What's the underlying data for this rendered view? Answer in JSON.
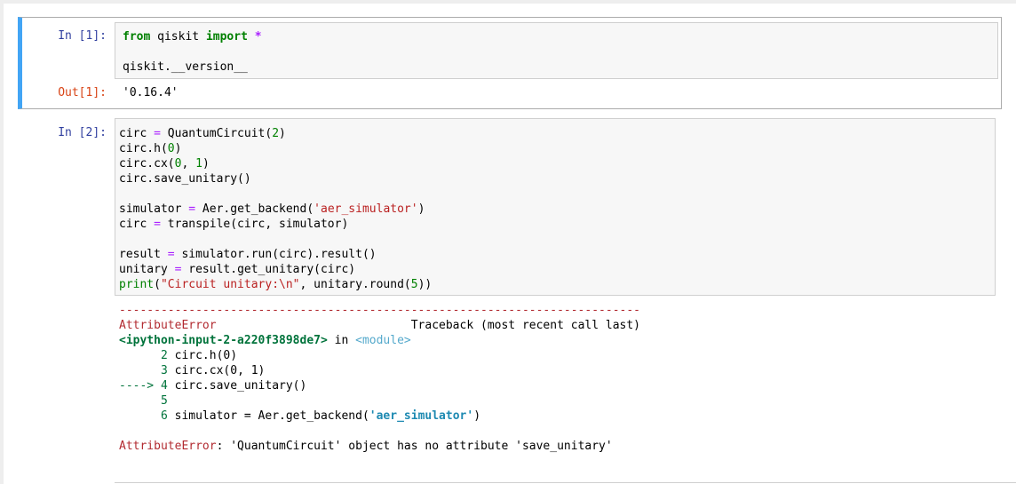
{
  "cell1": {
    "in_prompt": "In [1]:",
    "code_line1_kw1": "from",
    "code_line1_mod": " qiskit ",
    "code_line1_kw2": "import",
    "code_line1_star": " *",
    "code_line3": "qiskit.__version__",
    "out_prompt": "Out[1]:",
    "output": "'0.16.4'"
  },
  "cell2": {
    "in_prompt": "In [2]:",
    "code": {
      "l1a": "circ ",
      "l1eq": "=",
      "l1b": " QuantumCircuit(",
      "l1n": "2",
      "l1c": ")",
      "l2a": "circ.h(",
      "l2n": "0",
      "l2c": ")",
      "l3a": "circ.cx(",
      "l3n1": "0",
      "l3b": ", ",
      "l3n2": "1",
      "l3c": ")",
      "l4": "circ.save_unitary()",
      "l6a": "simulator ",
      "l6eq": "=",
      "l6b": " Aer.get_backend(",
      "l6s": "'aer_simulator'",
      "l6c": ")",
      "l7a": "circ ",
      "l7eq": "=",
      "l7b": " transpile(circ, simulator)",
      "l9a": "result ",
      "l9eq": "=",
      "l9b": " simulator.run(circ).result()",
      "l10a": "unitary ",
      "l10eq": "=",
      "l10b": " result.get_unitary(circ)",
      "l11bi": "print",
      "l11a": "(",
      "l11s": "\"Circuit unitary:\\n\"",
      "l11b": ", unitary.round(",
      "l11n": "5",
      "l11c": "))"
    },
    "traceback": {
      "dashes": "---------------------------------------------------------------------------",
      "err_name": "AttributeError",
      "header_right": "                            Traceback (most recent call last)",
      "location": "<ipython-input-2-a220f3898de7>",
      "in_text": " in ",
      "module": "<module>",
      "ln2_num": "      2",
      "ln2_code": " circ.h(0)",
      "ln3_num": "      3",
      "ln3_code": " circ.cx(0, 1)",
      "arrow": "----> 4",
      "ln4_code": " circ.save_unitary()",
      "ln5_num": "      5",
      "ln6_num": "      6",
      "ln6_code_a": " simulator = Aer.get_backend(",
      "ln6_str": "'aer_simulator'",
      "ln6_code_b": ")",
      "final_err": "AttributeError",
      "final_msg": ": 'QuantumCircuit' object has no attribute 'save_unitary'"
    }
  }
}
